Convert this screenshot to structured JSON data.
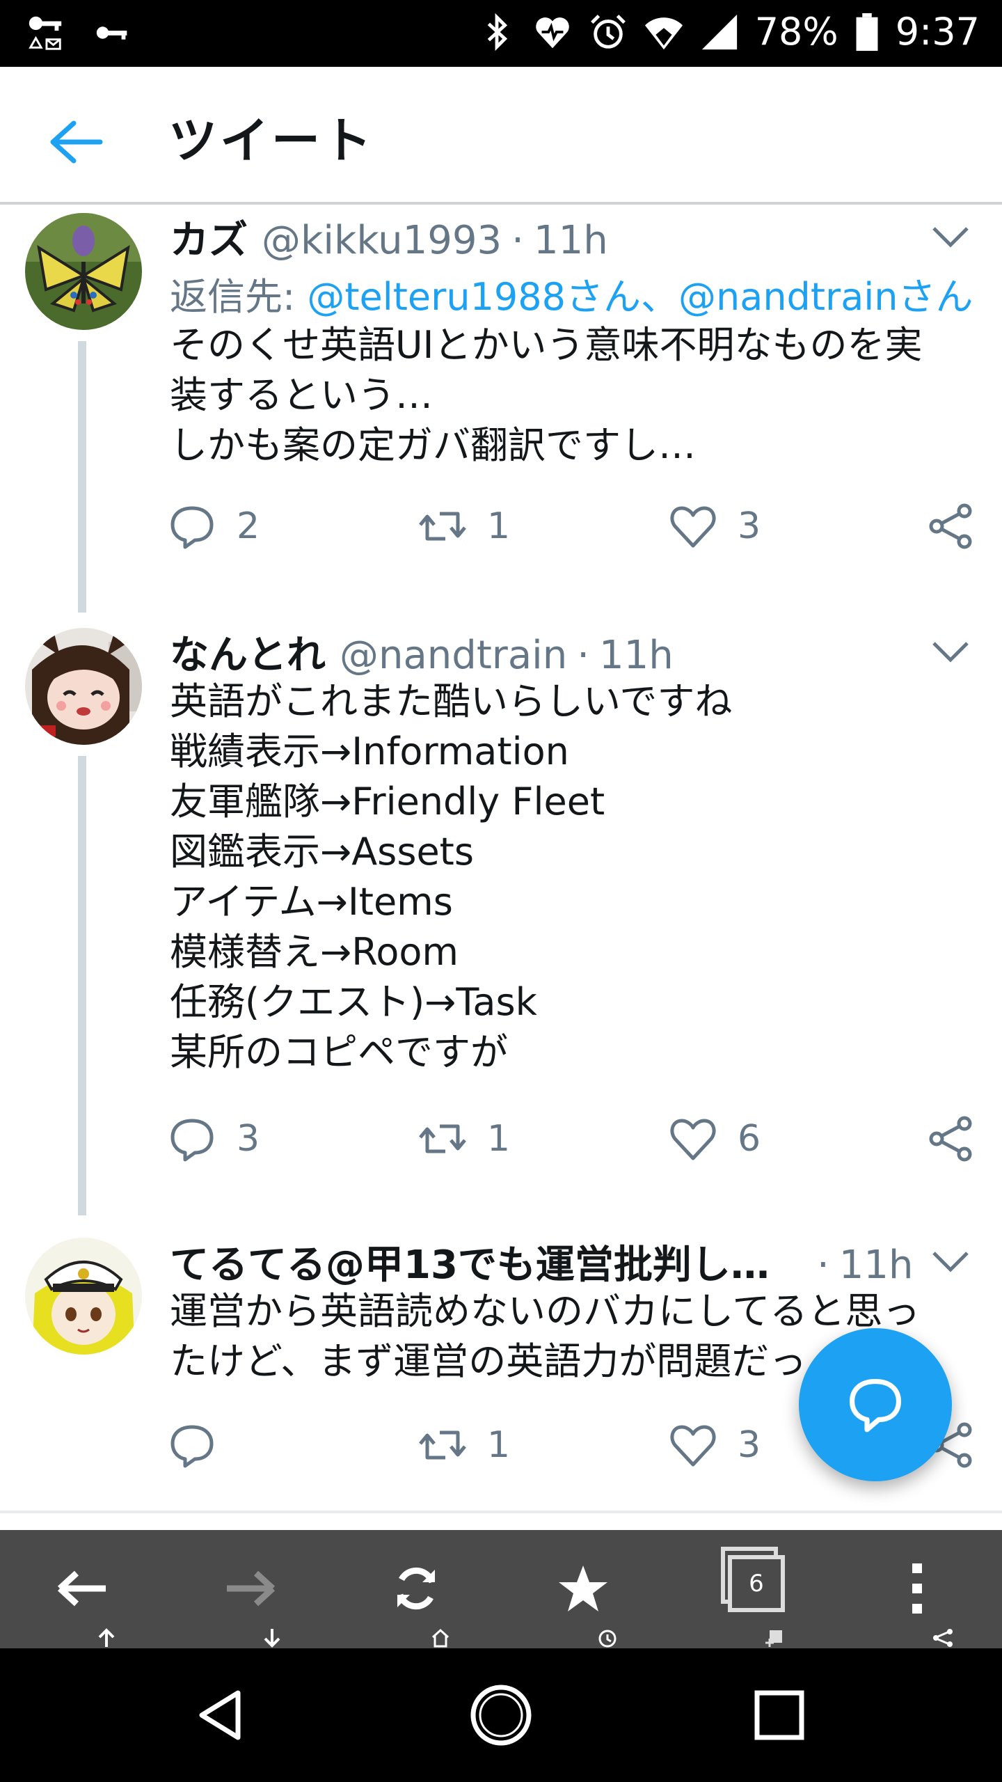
{
  "status_bar": {
    "battery": "78%",
    "time": "9:37",
    "icons": [
      "key-mail-icon",
      "key-icon",
      "bluetooth-icon",
      "heart-monitor-icon",
      "alarm-icon",
      "wifi-icon",
      "signal-icon",
      "battery-icon"
    ]
  },
  "header": {
    "title": "ツイート",
    "back_icon": "arrow-left-icon",
    "accent": "#1da1f2"
  },
  "tweets": [
    {
      "name": "カズ",
      "handle": "@kikku1993",
      "dot": "·",
      "time": "11h",
      "reply_to_prefix": "返信先: ",
      "reply_to_user1": "@telteru1988さん",
      "reply_to_sep": "、",
      "reply_to_user2": "@nandtrainさん",
      "body": "そのくせ英語UIとかいう意味不明なものを実\n装するという…\nしかも案の定ガバ翻訳ですし…",
      "replies": "2",
      "retweets": "1",
      "likes": "3"
    },
    {
      "name": "なんとれ",
      "handle": "@nandtrain",
      "dot": "·",
      "time": "11h",
      "body": "英語がこれまた酷いらしいですね\n戦績表示→Information\n友軍艦隊→Friendly Fleet\n図鑑表示→Assets\nアイテム→Items\n模様替え→Room\n任務(クエスト)→Task\n某所のコピペですが",
      "replies": "3",
      "retweets": "1",
      "likes": "6"
    },
    {
      "name": "てるてる@甲13でも運営批判し…",
      "handle": "",
      "dot": "·",
      "time": "11h",
      "body": "運営から英語読めないのバカにしてると思っ\nたけど、まず運営の英語力が問題だっ",
      "replies": "",
      "retweets": "1",
      "likes": "3"
    }
  ],
  "browser_toolbar": {
    "buttons": [
      "back-icon",
      "forward-icon",
      "reload-icon",
      "bookmark-star-icon",
      "tabs-icon",
      "menu-icon"
    ],
    "tab_count": "6"
  },
  "nav_bar": {
    "buttons": [
      "nav-back-icon",
      "nav-home-icon",
      "nav-recents-icon"
    ]
  }
}
